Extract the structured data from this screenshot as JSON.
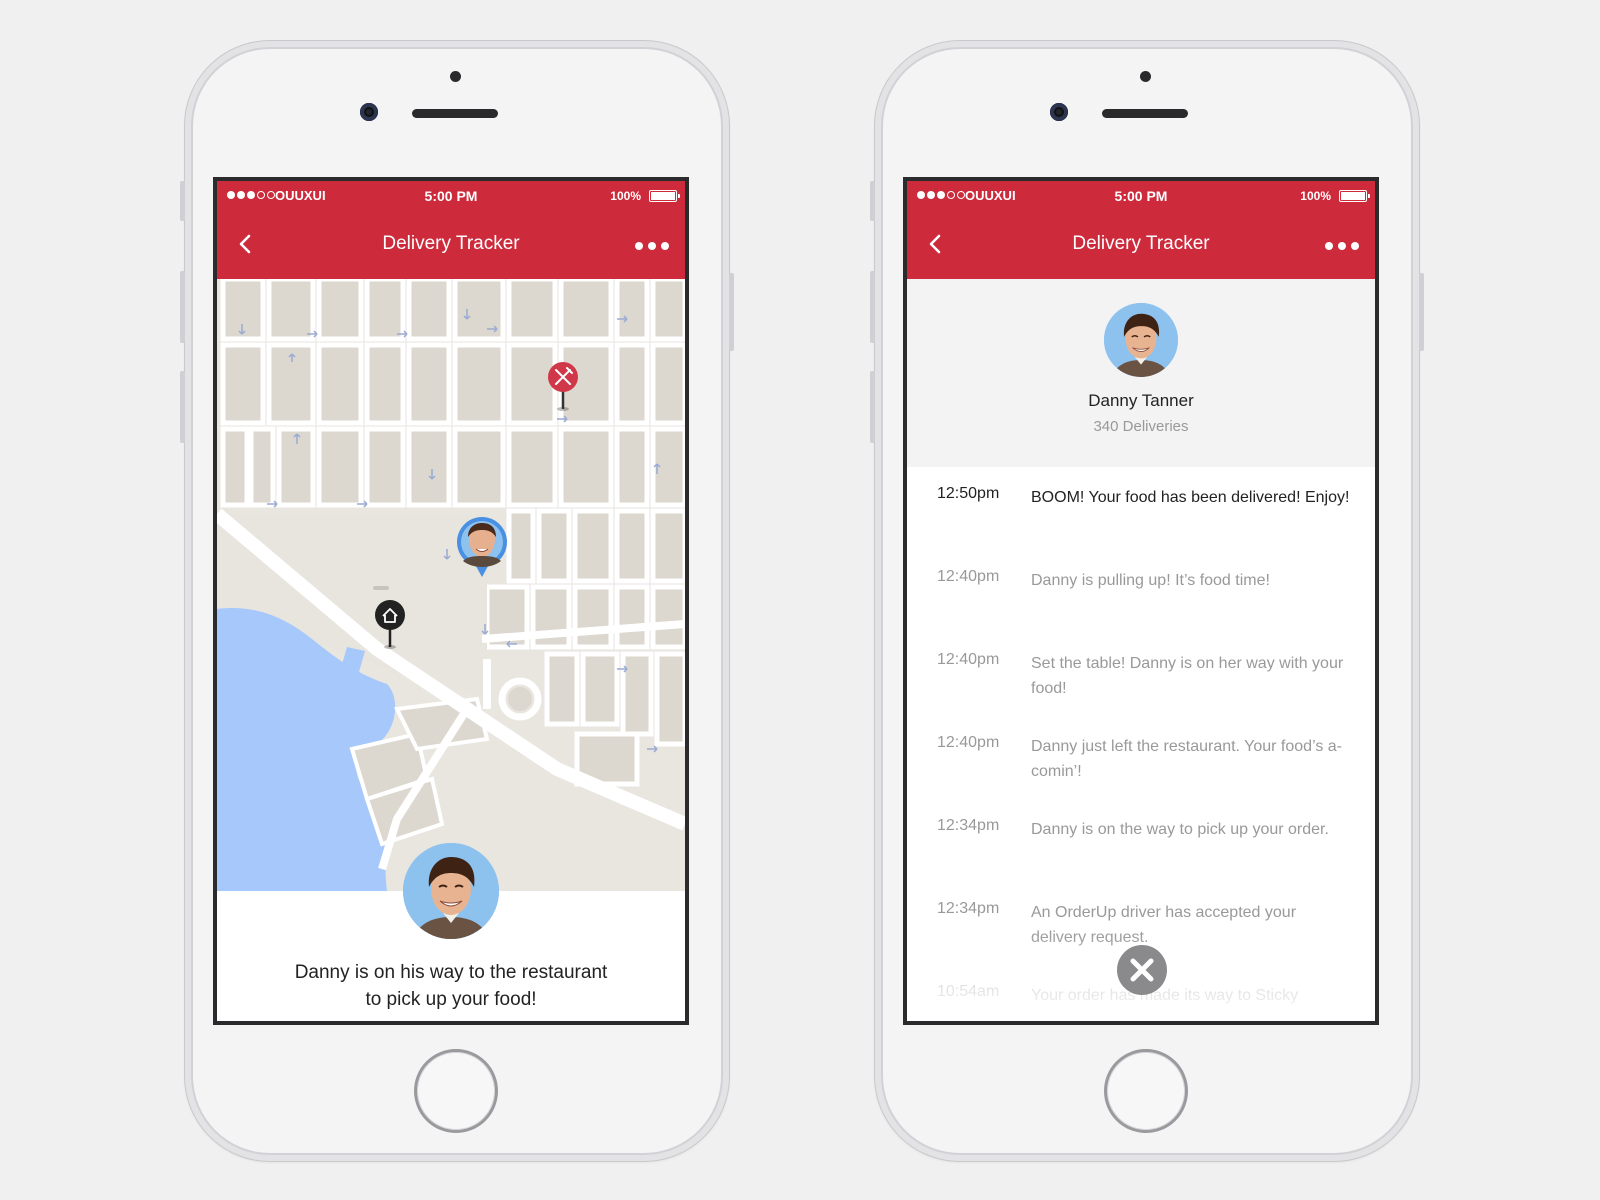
{
  "phones": [
    {
      "statusbar": {
        "carrier": "OUUXUI",
        "time": "5:00 PM",
        "battery": "100%"
      },
      "navbar": {
        "title": "Delivery Tracker",
        "back_icon": "chevron-left-icon",
        "more_icon": "ellipsis-icon"
      },
      "map": {
        "restaurant_pin_icon": "fork-knife-icon",
        "home_pin_icon": "home-icon",
        "driver_pin_icon": "driver-avatar"
      },
      "status_message": {
        "line1": "Danny is on his way to the restaurant",
        "line2": "to pick up your food!"
      }
    },
    {
      "statusbar": {
        "carrier": "OUUXUI",
        "time": "5:00 PM",
        "battery": "100%"
      },
      "navbar": {
        "title": "Delivery Tracker",
        "back_icon": "chevron-left-icon",
        "more_icon": "ellipsis-icon"
      },
      "driver": {
        "name": "Danny Tanner",
        "deliveries": "340 Deliveries"
      },
      "timeline": [
        {
          "time": "12:50pm",
          "message": "BOOM! Your food has been delivered! Enjoy!",
          "active": true
        },
        {
          "time": "12:40pm",
          "message": "Danny is pulling up! It’s food time!",
          "active": false
        },
        {
          "time": "12:40pm",
          "message": "Set the table! Danny is on her way with your food!",
          "active": false
        },
        {
          "time": "12:40pm",
          "message": "Danny just left the restaurant. Your food’s a-comin’!",
          "active": false
        },
        {
          "time": "12:34pm",
          "message": "Danny is on the way to pick up your order.",
          "active": false
        },
        {
          "time": "12:34pm",
          "message": "An OrderUp driver has accepted your delivery request.",
          "active": false
        },
        {
          "time": "10:54am",
          "message": "Your order has made its way to Sticky",
          "active": false
        }
      ],
      "close_icon": "close-icon"
    }
  ],
  "colors": {
    "brand_red": "#cd2a3c",
    "map_land": "#e8e5df",
    "map_water": "#a6c8fb",
    "driver_blue": "#4a90e2"
  }
}
